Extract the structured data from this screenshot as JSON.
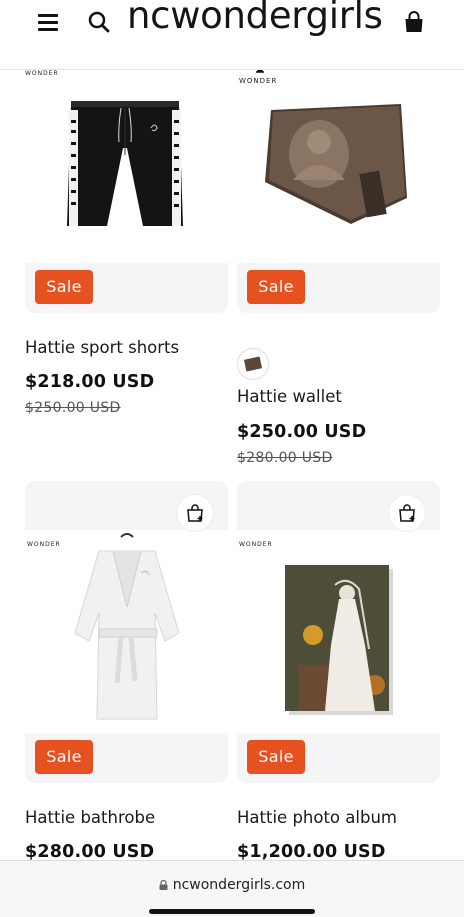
{
  "header": {
    "brand": "ncwondergirls",
    "menu_icon": "hamburger-menu-icon",
    "search_icon": "search-icon",
    "cart_icon": "shopping-bag-icon"
  },
  "colors": {
    "sale_badge": "#e5511f",
    "card_bg": "#f5f5f7"
  },
  "products": [
    {
      "brand_mark": "WONDER",
      "badge": "Sale",
      "title": "Hattie sport shorts",
      "price": "$218.00 USD",
      "compare_price": "$250.00 USD"
    },
    {
      "brand_mark": "WONDER",
      "badge": "Sale",
      "title": "Hattie wallet",
      "price": "$250.00 USD",
      "compare_price": "$280.00 USD"
    },
    {
      "brand_mark": "WONDER",
      "badge": "Sale",
      "title": "Hattie bathrobe",
      "price": "$280.00 USD"
    },
    {
      "brand_mark": "WONDER",
      "badge": "Sale",
      "title": "Hattie photo album",
      "price": "$1,200.00 USD"
    }
  ],
  "browser": {
    "url": "ncwondergirls.com"
  }
}
